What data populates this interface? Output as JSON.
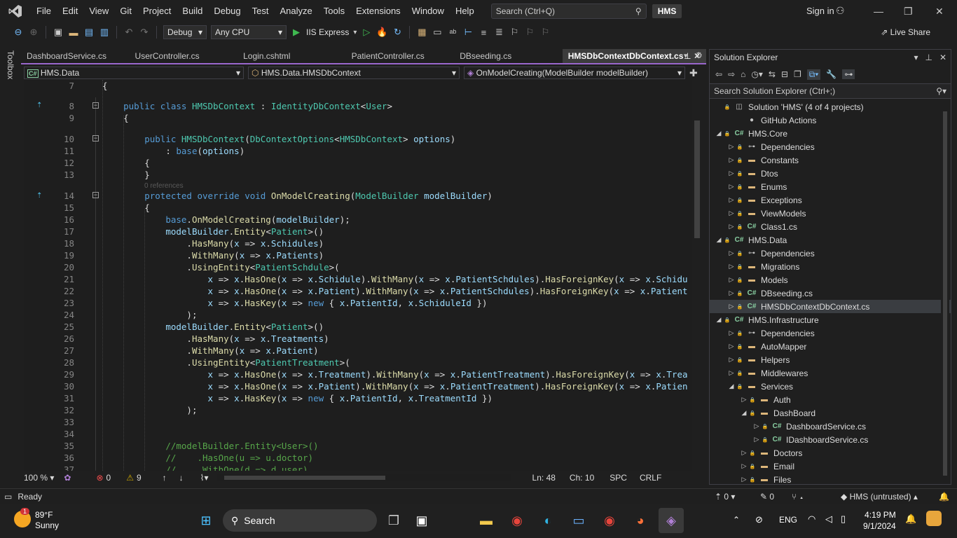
{
  "menubar": {
    "items": [
      "File",
      "Edit",
      "View",
      "Git",
      "Project",
      "Build",
      "Debug",
      "Test",
      "Analyze",
      "Tools",
      "Extensions",
      "Window",
      "Help"
    ],
    "search_placeholder": "Search (Ctrl+Q)",
    "solution_badge": "HMS",
    "signin": "Sign in"
  },
  "toolbar": {
    "config": "Debug",
    "platform": "Any CPU",
    "run_target": "IIS Express",
    "live_share": "Live Share"
  },
  "toolbox_label": "Toolbox",
  "tabs": [
    {
      "label": "DashboardService.cs"
    },
    {
      "label": "UserController.cs"
    },
    {
      "label": "Login.cshtml"
    },
    {
      "label": "PatientController.cs"
    },
    {
      "label": "DBseeding.cs"
    },
    {
      "label": "HMSDbContextDbContext.cs"
    }
  ],
  "navbar": {
    "project": "HMS.Data",
    "class": "HMS.Data.HMSDbContext",
    "member": "OnModelCreating(ModelBuilder modelBuilder)"
  },
  "code_lines": [
    {
      "n": "7",
      "html": "<span class='pl'>{</span>"
    },
    {
      "n": "8",
      "html": "    <span class='kw'>public class</span> <span class='ty'>HMSDbContext</span> <span class='pl'>: </span><span class='ty'>IdentityDbContext</span><span class='pl'>&lt;</span><span class='ty'>User</span><span class='pl'>&gt;</span>"
    },
    {
      "n": "9",
      "html": "    <span class='pl'>{</span>"
    },
    {
      "n": "10",
      "html": "        <span class='kw'>public</span> <span class='ty'>HMSDbContext</span><span class='pl'>(</span><span class='ty'>DbContextOptions</span><span class='pl'>&lt;</span><span class='ty'>HMSDbContext</span><span class='pl'>&gt; </span><span class='id'>options</span><span class='pl'>)</span>"
    },
    {
      "n": "11",
      "html": "            <span class='pl'>: </span><span class='kw'>base</span><span class='pl'>(</span><span class='id'>options</span><span class='pl'>)</span>"
    },
    {
      "n": "12",
      "html": "        <span class='pl'>{</span>"
    },
    {
      "n": "13",
      "html": "        <span class='pl'>}</span>"
    },
    {
      "n": "14",
      "html": "        <span class='kw'>protected override void</span> <span class='fn'>OnModelCreating</span><span class='pl'>(</span><span class='ty'>ModelBuilder</span> <span class='id'>modelBuilder</span><span class='pl'>)</span>"
    },
    {
      "n": "15",
      "html": "        <span class='pl'>{</span>"
    },
    {
      "n": "16",
      "html": "            <span class='kw'>base</span><span class='pl'>.</span><span class='fn'>OnModelCreating</span><span class='pl'>(</span><span class='id'>modelBuilder</span><span class='pl'>);</span>"
    },
    {
      "n": "17",
      "html": "            <span class='id'>modelBuilder</span><span class='pl'>.</span><span class='fn'>Entity</span><span class='pl'>&lt;</span><span class='ty'>Patient</span><span class='pl'>&gt;()</span>"
    },
    {
      "n": "18",
      "html": "                <span class='pl'>.</span><span class='fn'>HasMany</span><span class='pl'>(</span><span class='id'>x</span><span class='pl'> =&gt; </span><span class='id'>x</span><span class='pl'>.</span><span class='id'>Schidules</span><span class='pl'>)</span>"
    },
    {
      "n": "19",
      "html": "                <span class='pl'>.</span><span class='fn'>WithMany</span><span class='pl'>(</span><span class='id'>x</span><span class='pl'> =&gt; </span><span class='id'>x</span><span class='pl'>.</span><span class='id'>Patients</span><span class='pl'>)</span>"
    },
    {
      "n": "20",
      "html": "                <span class='pl'>.</span><span class='fn'>UsingEntity</span><span class='pl'>&lt;</span><span class='ty'>PatientSchdule</span><span class='pl'>&gt;(</span>"
    },
    {
      "n": "21",
      "html": "                    <span class='id'>x</span><span class='pl'> =&gt; </span><span class='id'>x</span><span class='pl'>.</span><span class='fn'>HasOne</span><span class='pl'>(</span><span class='id'>x</span><span class='pl'> =&gt; </span><span class='id'>x</span><span class='pl'>.</span><span class='id'>Schidule</span><span class='pl'>).</span><span class='fn'>WithMany</span><span class='pl'>(</span><span class='id'>x</span><span class='pl'> =&gt; </span><span class='id'>x</span><span class='pl'>.</span><span class='id'>PatientSchdules</span><span class='pl'>).</span><span class='fn'>HasForeignKey</span><span class='pl'>(</span><span class='id'>x</span><span class='pl'> =&gt; </span><span class='id'>x</span><span class='pl'>.</span><span class='id'>Schidu</span>"
    },
    {
      "n": "22",
      "html": "                    <span class='id'>x</span><span class='pl'> =&gt; </span><span class='id'>x</span><span class='pl'>.</span><span class='fn'>HasOne</span><span class='pl'>(</span><span class='id'>x</span><span class='pl'> =&gt; </span><span class='id'>x</span><span class='pl'>.</span><span class='id'>Patient</span><span class='pl'>).</span><span class='fn'>WithMany</span><span class='pl'>(</span><span class='id'>x</span><span class='pl'> =&gt; </span><span class='id'>x</span><span class='pl'>.</span><span class='id'>PatientSchdules</span><span class='pl'>).</span><span class='fn'>HasForeignKey</span><span class='pl'>(</span><span class='id'>x</span><span class='pl'> =&gt; </span><span class='id'>x</span><span class='pl'>.</span><span class='id'>Patient</span>"
    },
    {
      "n": "23",
      "html": "                    <span class='id'>x</span><span class='pl'> =&gt; </span><span class='id'>x</span><span class='pl'>.</span><span class='fn'>HasKey</span><span class='pl'>(</span><span class='id'>x</span><span class='pl'> =&gt; </span><span class='kw'>new</span><span class='pl'> { </span><span class='id'>x</span><span class='pl'>.</span><span class='id'>PatientId</span><span class='pl'>, </span><span class='id'>x</span><span class='pl'>.</span><span class='id'>SchiduleId</span><span class='pl'> })</span>"
    },
    {
      "n": "24",
      "html": "                <span class='pl'>);</span>"
    },
    {
      "n": "25",
      "html": "            <span class='id'>modelBuilder</span><span class='pl'>.</span><span class='fn'>Entity</span><span class='pl'>&lt;</span><span class='ty'>Patient</span><span class='pl'>&gt;()</span>"
    },
    {
      "n": "26",
      "html": "                <span class='pl'>.</span><span class='fn'>HasMany</span><span class='pl'>(</span><span class='id'>x</span><span class='pl'> =&gt; </span><span class='id'>x</span><span class='pl'>.</span><span class='id'>Treatments</span><span class='pl'>)</span>"
    },
    {
      "n": "27",
      "html": "                <span class='pl'>.</span><span class='fn'>WithMany</span><span class='pl'>(</span><span class='id'>x</span><span class='pl'> =&gt; </span><span class='id'>x</span><span class='pl'>.</span><span class='id'>Patient</span><span class='pl'>)</span>"
    },
    {
      "n": "28",
      "html": "                <span class='pl'>.</span><span class='fn'>UsingEntity</span><span class='pl'>&lt;</span><span class='ty'>PatientTreatment</span><span class='pl'>&gt;(</span>"
    },
    {
      "n": "29",
      "html": "                    <span class='id'>x</span><span class='pl'> =&gt; </span><span class='id'>x</span><span class='pl'>.</span><span class='fn'>HasOne</span><span class='pl'>(</span><span class='id'>x</span><span class='pl'> =&gt; </span><span class='id'>x</span><span class='pl'>.</span><span class='id'>Treatment</span><span class='pl'>).</span><span class='fn'>WithMany</span><span class='pl'>(</span><span class='id'>x</span><span class='pl'> =&gt; </span><span class='id'>x</span><span class='pl'>.</span><span class='id'>PatientTreatment</span><span class='pl'>).</span><span class='fn'>HasForeignKey</span><span class='pl'>(</span><span class='id'>x</span><span class='pl'> =&gt; </span><span class='id'>x</span><span class='pl'>.</span><span class='id'>Trea</span>"
    },
    {
      "n": "30",
      "html": "                    <span class='id'>x</span><span class='pl'> =&gt; </span><span class='id'>x</span><span class='pl'>.</span><span class='fn'>HasOne</span><span class='pl'>(</span><span class='id'>x</span><span class='pl'> =&gt; </span><span class='id'>x</span><span class='pl'>.</span><span class='id'>Patient</span><span class='pl'>).</span><span class='fn'>WithMany</span><span class='pl'>(</span><span class='id'>x</span><span class='pl'> =&gt; </span><span class='id'>x</span><span class='pl'>.</span><span class='id'>PatientTreatment</span><span class='pl'>).</span><span class='fn'>HasForeignKey</span><span class='pl'>(</span><span class='id'>x</span><span class='pl'> =&gt; </span><span class='id'>x</span><span class='pl'>.</span><span class='id'>Patien</span>"
    },
    {
      "n": "31",
      "html": "                    <span class='id'>x</span><span class='pl'> =&gt; </span><span class='id'>x</span><span class='pl'>.</span><span class='fn'>HasKey</span><span class='pl'>(</span><span class='id'>x</span><span class='pl'> =&gt; </span><span class='kw'>new</span><span class='pl'> { </span><span class='id'>x</span><span class='pl'>.</span><span class='id'>PatientId</span><span class='pl'>, </span><span class='id'>x</span><span class='pl'>.</span><span class='id'>TreatmentId</span><span class='pl'> })</span>"
    },
    {
      "n": "32",
      "html": "                <span class='pl'>);</span>"
    },
    {
      "n": "33",
      "html": ""
    },
    {
      "n": "34",
      "html": ""
    },
    {
      "n": "35",
      "html": "            <span class='cm'>//modelBuilder.Entity&lt;User&gt;()</span>"
    },
    {
      "n": "36",
      "html": "            <span class='cm'>//    .HasOne(u =&gt; u.doctor)</span>"
    },
    {
      "n": "37",
      "html": "            <span class='cm'>//    .WithOne(d =&gt; d.user)</span>"
    }
  ],
  "references_hint": "0 references",
  "editor_status": {
    "zoom": "100 %",
    "errors": "0",
    "warnings": "9",
    "line": "Ln: 48",
    "col": "Ch: 10",
    "mode": "SPC",
    "eol": "CRLF"
  },
  "solution_explorer": {
    "title": "Solution Explorer",
    "search_placeholder": "Search Solution Explorer (Ctrl+;)",
    "tree": [
      {
        "d": 0,
        "tw": "",
        "icon": "sol",
        "label": "Solution 'HMS' (4 of 4 projects)"
      },
      {
        "d": 1,
        "tw": "",
        "icon": "gh",
        "label": "GitHub Actions"
      },
      {
        "d": 0,
        "tw": "◢",
        "icon": "proj",
        "label": "HMS.Core"
      },
      {
        "d": 1,
        "tw": "▷",
        "icon": "dep",
        "label": "Dependencies"
      },
      {
        "d": 1,
        "tw": "▷",
        "icon": "folder",
        "label": "Constants"
      },
      {
        "d": 1,
        "tw": "▷",
        "icon": "folder",
        "label": "Dtos"
      },
      {
        "d": 1,
        "tw": "▷",
        "icon": "folder",
        "label": "Enums"
      },
      {
        "d": 1,
        "tw": "▷",
        "icon": "folder",
        "label": "Exceptions"
      },
      {
        "d": 1,
        "tw": "▷",
        "icon": "folder",
        "label": "ViewModels"
      },
      {
        "d": 1,
        "tw": "▷",
        "icon": "cs",
        "label": "Class1.cs"
      },
      {
        "d": 0,
        "tw": "◢",
        "icon": "proj",
        "label": "HMS.Data"
      },
      {
        "d": 1,
        "tw": "▷",
        "icon": "dep",
        "label": "Dependencies"
      },
      {
        "d": 1,
        "tw": "▷",
        "icon": "folder",
        "label": "Migrations"
      },
      {
        "d": 1,
        "tw": "▷",
        "icon": "folder",
        "label": "Models"
      },
      {
        "d": 1,
        "tw": "▷",
        "icon": "cs",
        "label": "DBseeding.cs"
      },
      {
        "d": 1,
        "tw": "▷",
        "icon": "cs",
        "label": "HMSDbContextDbContext.cs",
        "sel": true
      },
      {
        "d": 0,
        "tw": "◢",
        "icon": "proj",
        "label": "HMS.Infrastructure"
      },
      {
        "d": 1,
        "tw": "▷",
        "icon": "dep",
        "label": "Dependencies"
      },
      {
        "d": 1,
        "tw": "▷",
        "icon": "folder",
        "label": "AutoMapper"
      },
      {
        "d": 1,
        "tw": "▷",
        "icon": "folder",
        "label": "Helpers"
      },
      {
        "d": 1,
        "tw": "▷",
        "icon": "folder",
        "label": "Middlewares"
      },
      {
        "d": 1,
        "tw": "◢",
        "icon": "folder",
        "label": "Services"
      },
      {
        "d": 2,
        "tw": "▷",
        "icon": "folder",
        "label": "Auth"
      },
      {
        "d": 2,
        "tw": "◢",
        "icon": "folder",
        "label": "DashBoard"
      },
      {
        "d": 3,
        "tw": "▷",
        "icon": "cs",
        "label": "DashboardService.cs"
      },
      {
        "d": 3,
        "tw": "▷",
        "icon": "cs",
        "label": "IDashboardService.cs"
      },
      {
        "d": 2,
        "tw": "▷",
        "icon": "folder",
        "label": "Doctors"
      },
      {
        "d": 2,
        "tw": "▷",
        "icon": "folder",
        "label": "Email"
      },
      {
        "d": 2,
        "tw": "▷",
        "icon": "folder",
        "label": "Files"
      }
    ]
  },
  "statusbar": {
    "ready": "Ready",
    "changes": "0",
    "edits": "0",
    "repo": "HMS (untrusted)"
  },
  "taskbar": {
    "weather_temp": "89°F",
    "weather_desc": "Sunny",
    "weather_badge": "1",
    "search_label": "Search",
    "language": "ENG",
    "time": "4:19 PM",
    "date": "9/1/2024"
  }
}
